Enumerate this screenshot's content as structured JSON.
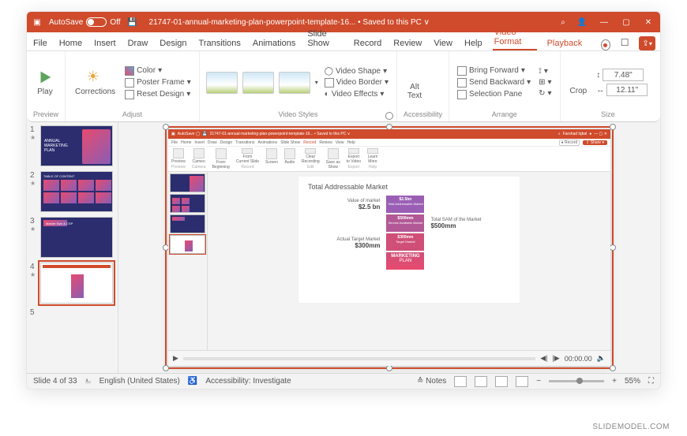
{
  "titlebar": {
    "autosave_label": "AutoSave",
    "autosave_state": "Off",
    "doc_name": "21747-01-annual-marketing-plan-powerpoint-template-16... • Saved to this PC ∨",
    "search_icon": "⌕",
    "minimize": "—",
    "maximize": "▢",
    "close": "✕"
  },
  "tabs": {
    "file": "File",
    "home": "Home",
    "insert": "Insert",
    "draw": "Draw",
    "design": "Design",
    "transitions": "Transitions",
    "animations": "Animations",
    "slideshow": "Slide Show",
    "record": "Record",
    "review": "Review",
    "view": "View",
    "help": "Help",
    "vformat": "Video Format",
    "playback": "Playback"
  },
  "ribbon": {
    "preview": {
      "play": "Play",
      "group": "Preview"
    },
    "adjust": {
      "corrections": "Corrections",
      "color": "Color",
      "poster": "Poster Frame",
      "reset": "Reset Design",
      "group": "Adjust"
    },
    "styles": {
      "shape": "Video Shape",
      "border": "Video Border",
      "effects": "Video Effects",
      "group": "Video Styles"
    },
    "acc": {
      "alt": "Alt\nText",
      "group": "Accessibility"
    },
    "arrange": {
      "forward": "Bring Forward",
      "backward": "Send Backward",
      "selpane": "Selection Pane",
      "align": "⟟",
      "group_g": "⊞",
      "rotate": "↻",
      "group": "Arrange"
    },
    "size": {
      "crop": "Crop",
      "height": "7.48\"",
      "width": "12.11\"",
      "group": "Size"
    }
  },
  "thumbnails": [
    {
      "n": "1"
    },
    {
      "n": "2"
    },
    {
      "n": "3"
    },
    {
      "n": "4"
    },
    {
      "n": "5"
    }
  ],
  "thumb_text": {
    "slide1_l1": "ANNUAL",
    "slide1_l2": "MARKETING",
    "slide1_l3": "PLAN",
    "slide2_title": "TABLE OF CONTENT",
    "slide3_title": "Market Size & CSP"
  },
  "embedded": {
    "title_doc": "21747-01-annual-marketing-plan-powerpoint-template-16... • Saved to this PC ∨",
    "user": "Farshad Iqbal",
    "tabs": {
      "file": "File",
      "home": "Home",
      "insert": "Insert",
      "draw": "Draw",
      "design": "Design",
      "transitions": "Transitions",
      "animations": "Animations",
      "slideshow": "Slide Show",
      "record": "Record",
      "review": "Review",
      "view": "View",
      "help": "Help"
    },
    "rib": {
      "preview": "Preview",
      "cameo": "Cameo",
      "from_beg": "From\nBeginning",
      "from_cur": "From\nCurrent Slide",
      "screen": "Screen",
      "audio": "Audio",
      "clear": "Clear\nRecording",
      "saveas": "Save as\nShow",
      "export": "Export\nto Video",
      "learn": "Learn\nMore",
      "g_preview": "Preview",
      "g_camera": "Camera",
      "g_record": "Record",
      "g_edit": "Edit",
      "g_export": "Export",
      "g_help": "Help",
      "rec_btn": "Record",
      "share_btn": "Share"
    },
    "slide": {
      "title": "Total Addressable Market",
      "vom_label": "Value of market",
      "vom_val": "$2.5 bn",
      "atm_label": "Actual Target Market",
      "atm_val": "$300mm",
      "tsam_label": "Total SAM of the Market",
      "tsam_val": "$500mm",
      "box1_v": "$2.5bn",
      "box1_l": "Total Addressable Market",
      "box2_v": "$500mm",
      "box2_l": "Service Available Market",
      "box3_v": "$300mm",
      "box3_l": "Target Market",
      "box4_a": "MARKETING",
      "box4_b": "PLAN"
    }
  },
  "video": {
    "time": "00:00.00"
  },
  "status": {
    "slide": "Slide 4 of 33",
    "lang": "English (United States)",
    "access": "Accessibility: Investigate",
    "notes": "Notes",
    "zoom": "55%"
  },
  "watermark": "SLIDEMODEL.COM"
}
